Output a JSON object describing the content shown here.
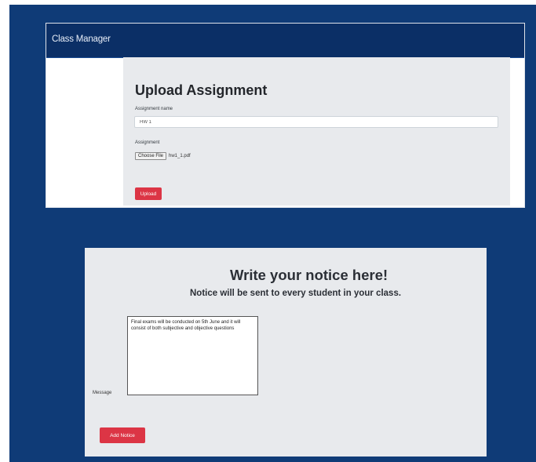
{
  "navbar": {
    "brand": "Class Manager"
  },
  "upload": {
    "title": "Upload Assignment",
    "name_label": "Assignment name",
    "name_value": "HW 1",
    "file_label": "Assignment",
    "choose_file_label": "Choose File",
    "file_name": "hw1_1.pdf",
    "submit_label": "Upload"
  },
  "notice": {
    "title": "Write your notice here!",
    "subtitle": "Notice will be sent to every student in your class.",
    "message_label": "Message",
    "message_value": "Final exams will be conducted on 5th June and it will consist of both subjective and objective questions",
    "submit_label": "Add Notice"
  },
  "colors": {
    "page_background": "#0f3b77",
    "navbar": "#0b2f66",
    "panel": "#e8eaed",
    "accent_button": "#dc3545"
  }
}
